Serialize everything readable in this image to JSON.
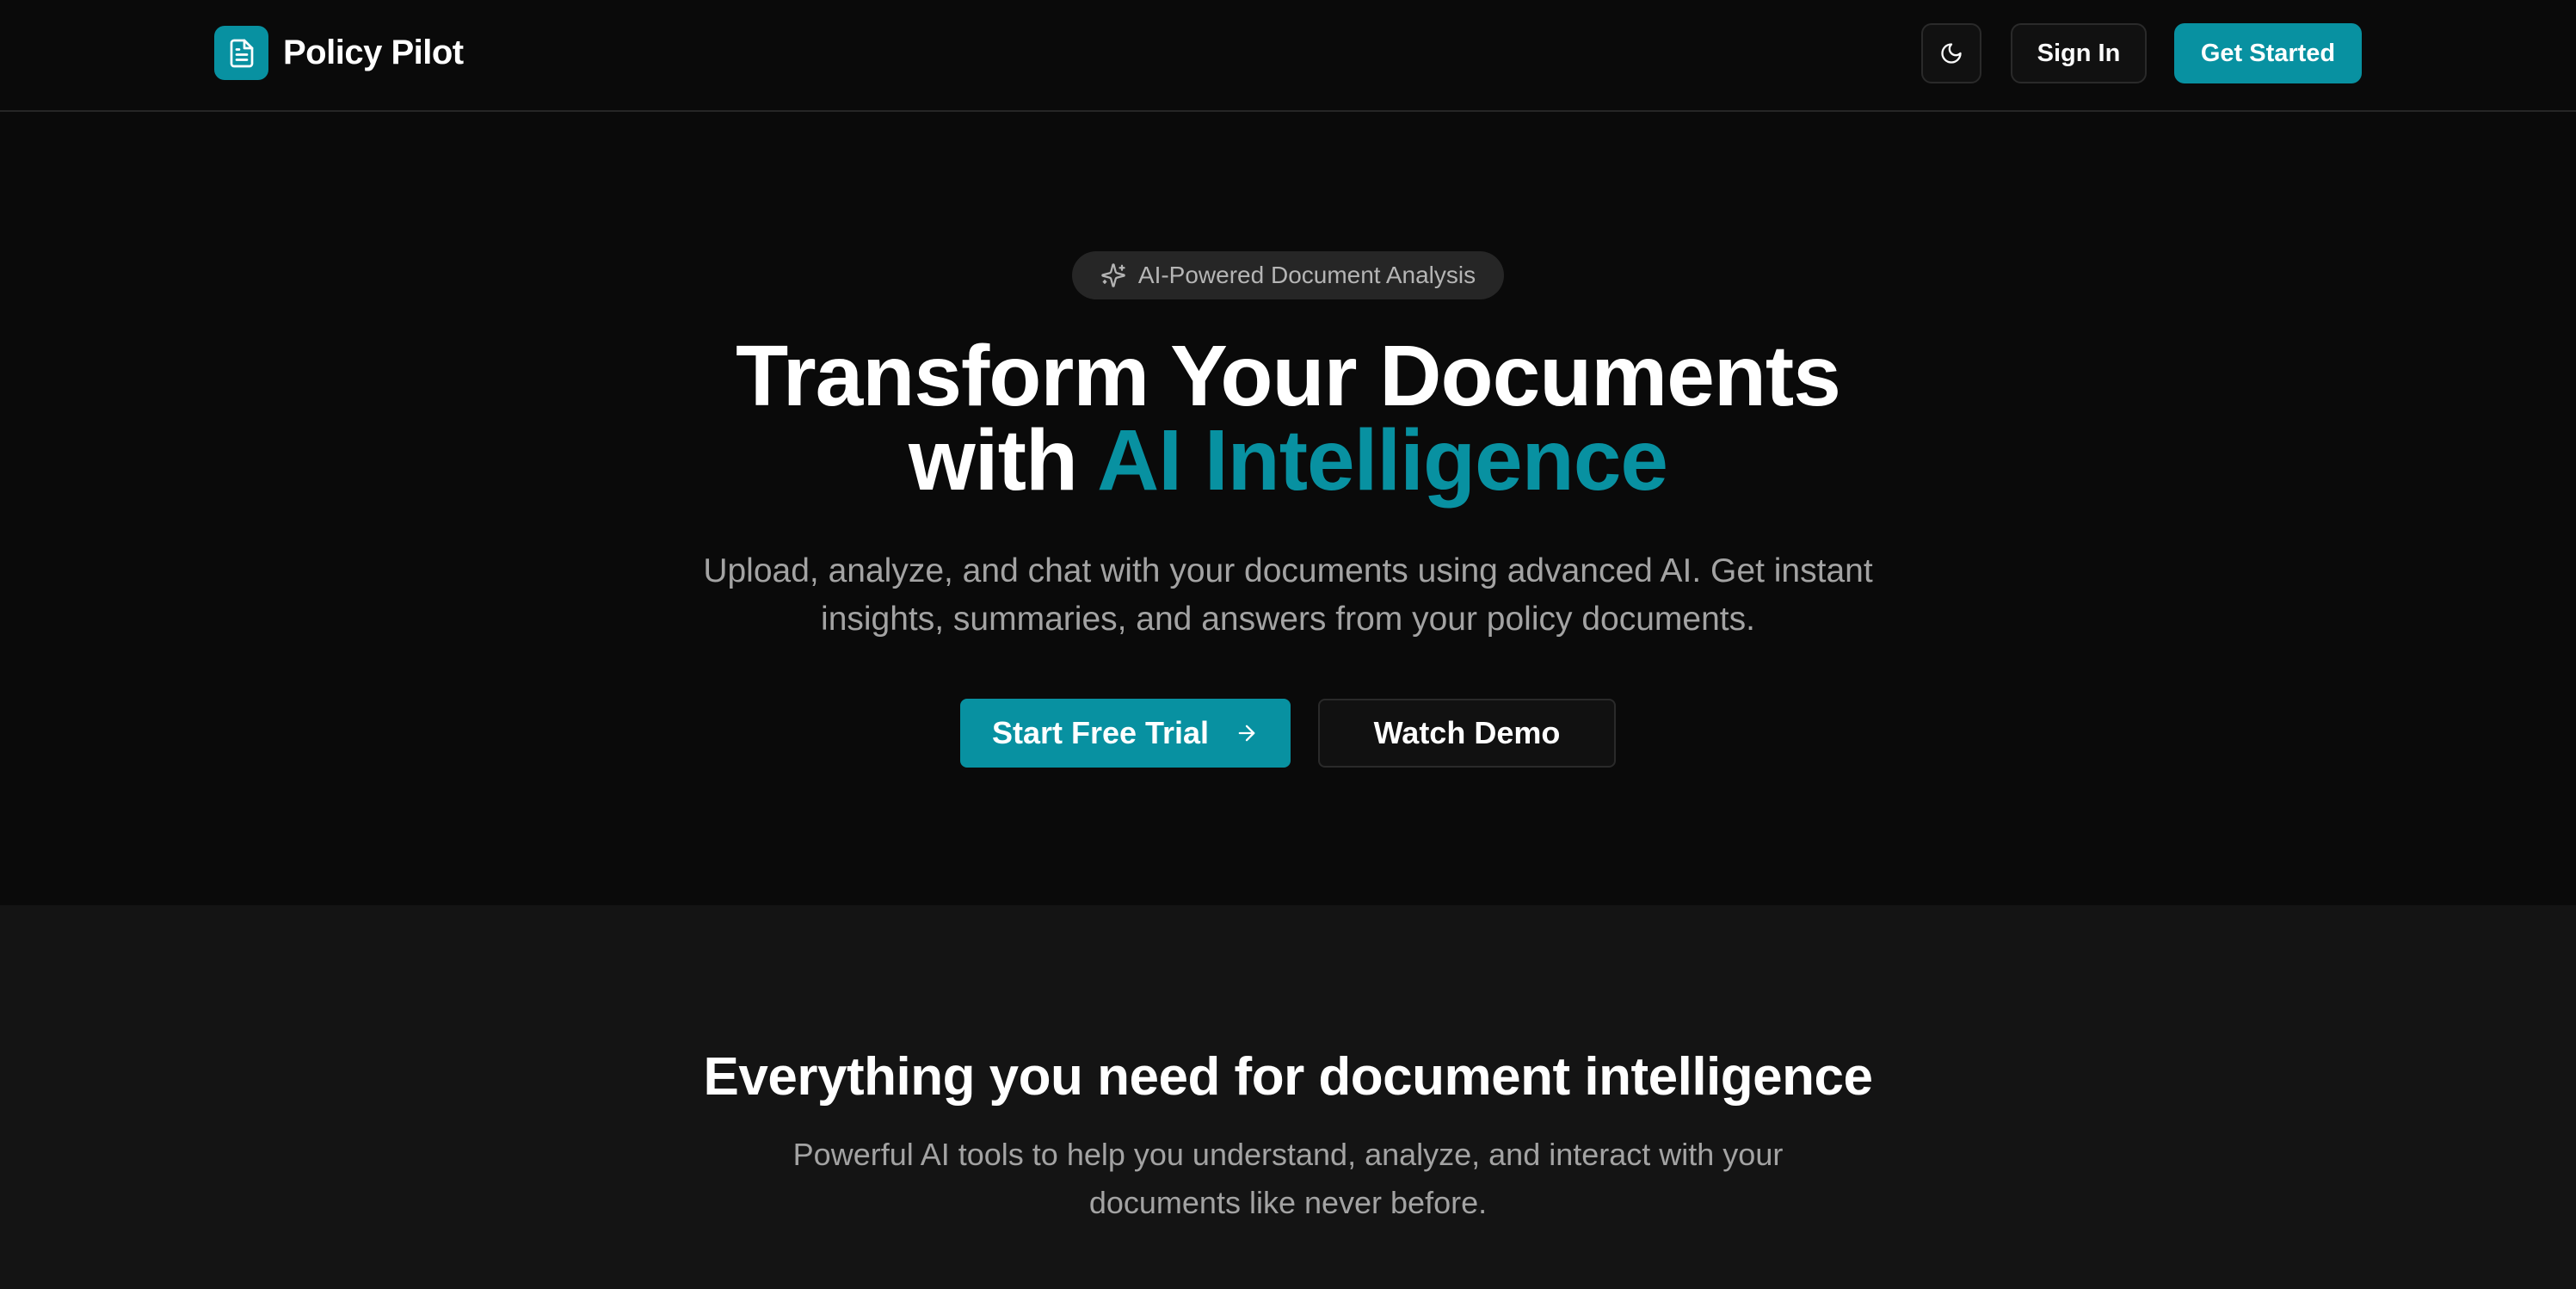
{
  "navbar": {
    "brand_name": "Policy Pilot",
    "logo_icon": "document-icon",
    "theme_icon": "moon-icon",
    "signin_label": "Sign In",
    "get_started_label": "Get Started"
  },
  "hero": {
    "badge_icon": "sparkles-icon",
    "badge_text": "AI-Powered Document Analysis",
    "title_line1": "Transform Your Documents",
    "title_line2_plain": "with ",
    "title_line2_accent": "AI Intelligence",
    "subtitle": "Upload, analyze, and chat with your documents using advanced AI. Get instant insights, summaries, and answers from your policy documents.",
    "primary_cta_label": "Start Free Trial",
    "primary_cta_icon": "arrow-right-icon",
    "secondary_cta_label": "Watch Demo"
  },
  "features": {
    "title": "Everything you need for document intelligence",
    "subtitle": "Powerful AI tools to help you understand, analyze, and interact with your documents like never before."
  },
  "colors": {
    "accent": "#0891a1",
    "background": "#0a0a0a",
    "section_background": "#141414",
    "muted_text": "#a3a3a3"
  }
}
